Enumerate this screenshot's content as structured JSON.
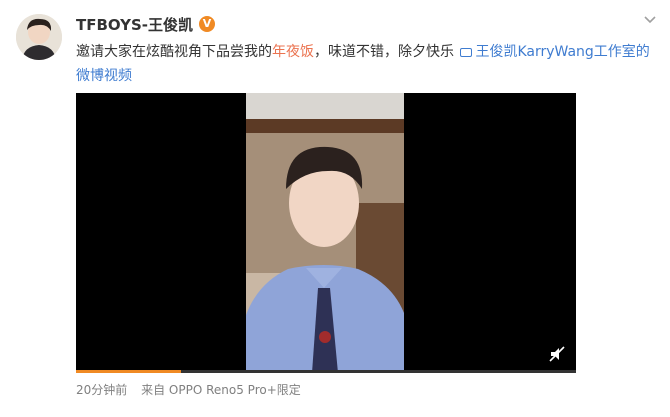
{
  "post": {
    "username": "TFBOYS-王俊凯",
    "verified_badge": "V",
    "text_before": "邀请大家在炫酷视角下品尝我的",
    "topic_link": "年夜饭",
    "text_after": "，味道不错，除夕快乐 ",
    "video_link": "王俊凯KarryWang工作室的微博视频",
    "time": "20分钟前",
    "source": "来自 OPPO Reno5 Pro+限定",
    "video_progress": 0.21
  },
  "icons": {
    "more": "chevron-down-icon",
    "video_link": "video-icon",
    "mute": "mute-icon"
  },
  "colors": {
    "link_orange": "#eb7350",
    "link_blue": "#3f7cd0",
    "badge": "#f08a24"
  }
}
